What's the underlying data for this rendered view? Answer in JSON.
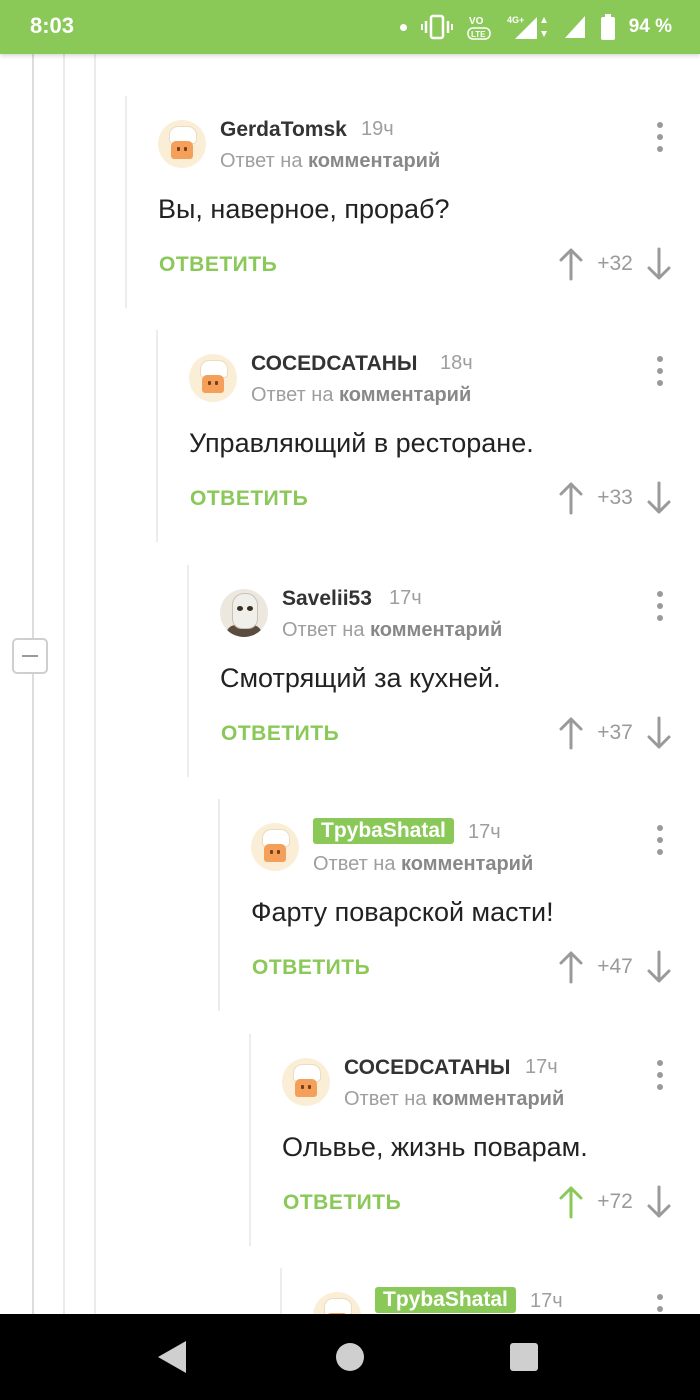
{
  "status_bar": {
    "time": "8:03",
    "network_volte": "VoLTE",
    "network_type": "4G+",
    "battery": "94 %"
  },
  "reply_prefix": "Ответ на",
  "reply_link": "комментарий",
  "reply_button": "ОТВЕТИТЬ",
  "comments": [
    {
      "username": "GerdaTomsk",
      "time": "19ч",
      "text": "Вы, наверное, прораб?",
      "score": "+32",
      "upvoted": false,
      "highlighted": false,
      "avatar": "chef-avatar"
    },
    {
      "username": "СОСЕDСАТАНЫ",
      "time": "18ч",
      "text": "Управляющий в ресторане.",
      "score": "+33",
      "upvoted": false,
      "highlighted": false,
      "avatar": "chef-avatar"
    },
    {
      "username": "Savelii53",
      "time": "17ч",
      "text": "Смотрящий за кухней.",
      "score": "+37",
      "upvoted": false,
      "highlighted": false,
      "avatar": "hockey-mask-avatar"
    },
    {
      "username": "TpybaShatal",
      "time": "17ч",
      "text": "Фарту поварской масти!",
      "score": "+47",
      "upvoted": false,
      "highlighted": true,
      "avatar": "chef-avatar"
    },
    {
      "username": "СОСЕDСАТАНЫ",
      "time": "17ч",
      "text": "Ольвье, жизнь поварам.",
      "score": "+72",
      "upvoted": true,
      "highlighted": false,
      "avatar": "chef-avatar"
    },
    {
      "username": "TpybaShatal",
      "time": "17ч",
      "highlighted": true,
      "avatar": "chef-avatar"
    }
  ],
  "colors": {
    "accent": "#8ac858",
    "upvote_active": "#8ac858",
    "muted": "#9e9e9e"
  }
}
